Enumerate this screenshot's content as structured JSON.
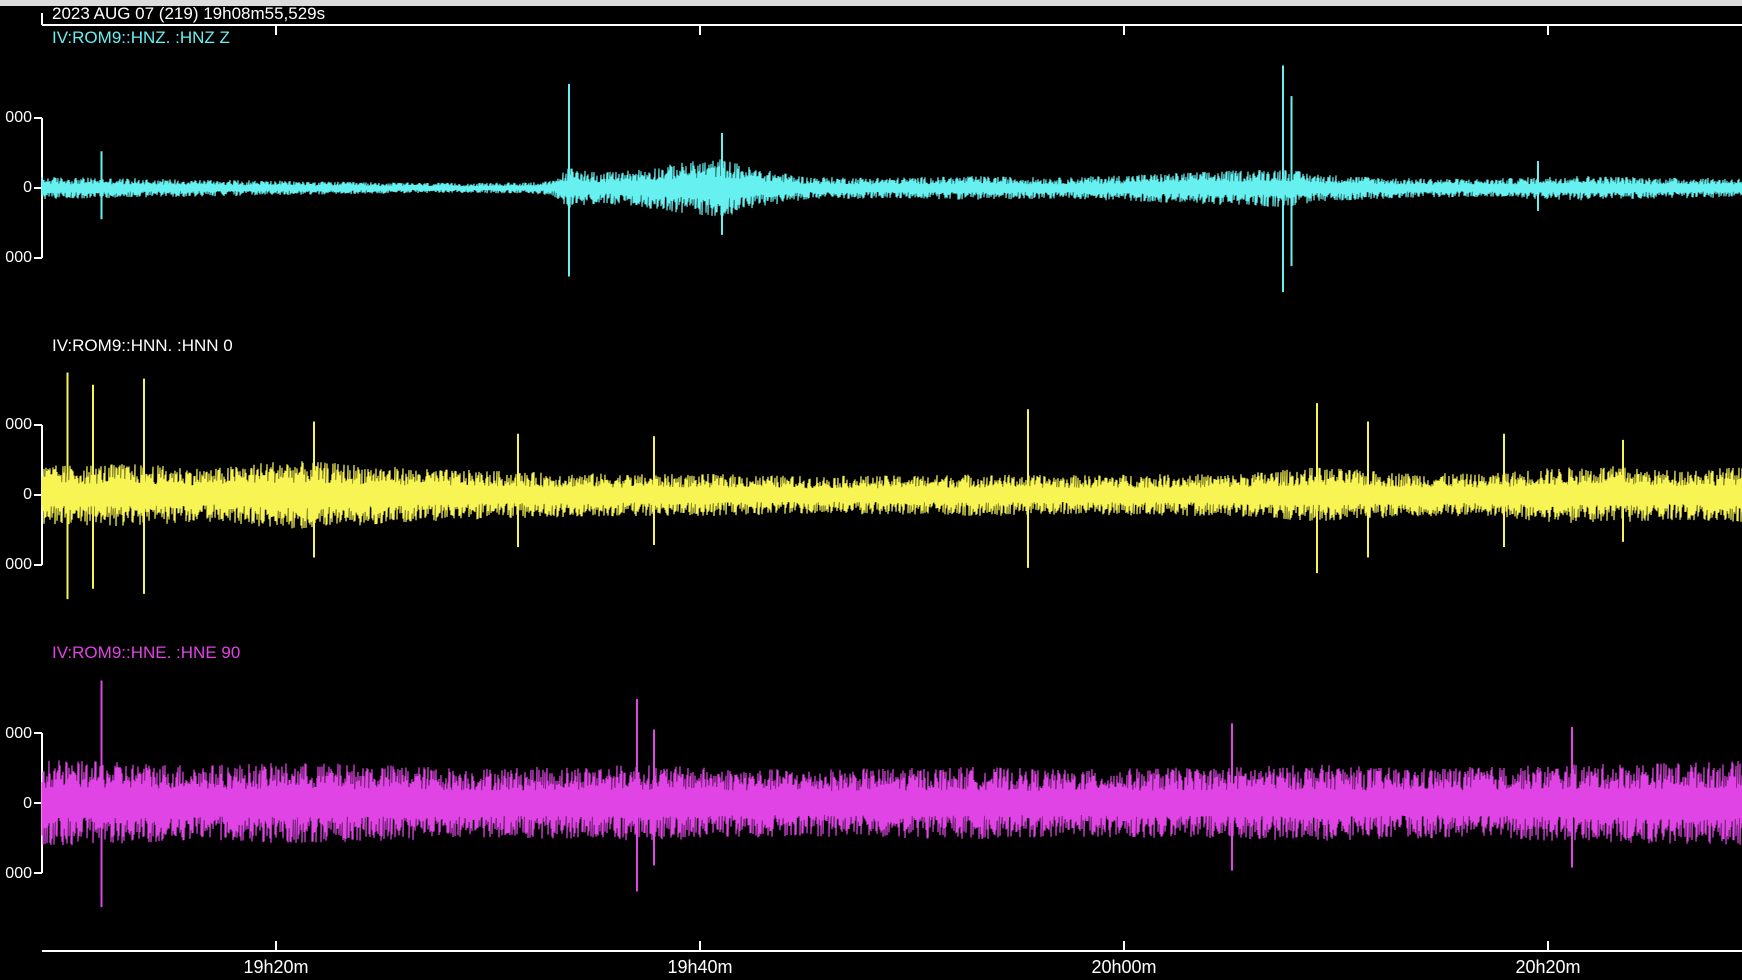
{
  "header": {
    "timestamp": "2023 AUG 07 (219)  19h08m55,529s"
  },
  "colors": {
    "background": "#000000",
    "axis": "#ffffff",
    "top_bar": "#dcdcdc"
  },
  "chart_data": {
    "type": "line",
    "title": "",
    "xlabel": "",
    "ylabel": "",
    "x_axis": {
      "start_time": "19h08m55,529s",
      "tick_labels": [
        "19h20m",
        "19h40m",
        "20h00m",
        "20h20m"
      ]
    },
    "series": [
      {
        "name": "IV:ROM9::HNZ.  :HNZ Z",
        "color": "#66f0f0",
        "ytick_labels": [
          "000",
          "0",
          "000"
        ],
        "envelope": [
          [
            0.0,
            0.16
          ],
          [
            0.05,
            0.14
          ],
          [
            0.1,
            0.12
          ],
          [
            0.15,
            0.1
          ],
          [
            0.2,
            0.08
          ],
          [
            0.25,
            0.07
          ],
          [
            0.28,
            0.08
          ],
          [
            0.3,
            0.1
          ],
          [
            0.31,
            0.3
          ],
          [
            0.33,
            0.22
          ],
          [
            0.36,
            0.3
          ],
          [
            0.38,
            0.38
          ],
          [
            0.4,
            0.42
          ],
          [
            0.42,
            0.28
          ],
          [
            0.45,
            0.16
          ],
          [
            0.5,
            0.15
          ],
          [
            0.55,
            0.17
          ],
          [
            0.6,
            0.15
          ],
          [
            0.65,
            0.2
          ],
          [
            0.7,
            0.25
          ],
          [
            0.73,
            0.28
          ],
          [
            0.75,
            0.2
          ],
          [
            0.8,
            0.14
          ],
          [
            0.85,
            0.13
          ],
          [
            0.9,
            0.18
          ],
          [
            0.95,
            0.15
          ],
          [
            1.0,
            0.14
          ]
        ],
        "spikes": [
          [
            0.035,
            0.3
          ],
          [
            0.31,
            0.85
          ],
          [
            0.4,
            0.45
          ],
          [
            0.73,
            1.0
          ],
          [
            0.735,
            0.75
          ],
          [
            0.88,
            0.22
          ]
        ]
      },
      {
        "name": "IV:ROM9::HNN.  :HNN 0",
        "color": "#f8f454",
        "ytick_labels": [
          "000",
          "0",
          "000"
        ],
        "envelope": [
          [
            0.0,
            0.42
          ],
          [
            0.05,
            0.45
          ],
          [
            0.1,
            0.38
          ],
          [
            0.14,
            0.5
          ],
          [
            0.18,
            0.45
          ],
          [
            0.22,
            0.38
          ],
          [
            0.3,
            0.32
          ],
          [
            0.35,
            0.3
          ],
          [
            0.4,
            0.3
          ],
          [
            0.45,
            0.27
          ],
          [
            0.5,
            0.28
          ],
          [
            0.55,
            0.3
          ],
          [
            0.6,
            0.28
          ],
          [
            0.65,
            0.3
          ],
          [
            0.7,
            0.3
          ],
          [
            0.75,
            0.4
          ],
          [
            0.8,
            0.32
          ],
          [
            0.85,
            0.3
          ],
          [
            0.88,
            0.38
          ],
          [
            0.92,
            0.42
          ],
          [
            0.95,
            0.36
          ],
          [
            1.0,
            0.4
          ]
        ],
        "spikes": [
          [
            0.015,
            1.0
          ],
          [
            0.03,
            0.9
          ],
          [
            0.06,
            0.95
          ],
          [
            0.16,
            0.6
          ],
          [
            0.28,
            0.5
          ],
          [
            0.36,
            0.48
          ],
          [
            0.58,
            0.7
          ],
          [
            0.75,
            0.75
          ],
          [
            0.78,
            0.6
          ],
          [
            0.86,
            0.5
          ],
          [
            0.93,
            0.45
          ]
        ]
      },
      {
        "name": "IV:ROM9::HNE.  :HNE 90",
        "color": "#e044e4",
        "ytick_labels": [
          "000",
          "0",
          "000"
        ],
        "envelope": [
          [
            0.0,
            0.62
          ],
          [
            0.05,
            0.58
          ],
          [
            0.1,
            0.55
          ],
          [
            0.15,
            0.58
          ],
          [
            0.2,
            0.55
          ],
          [
            0.25,
            0.5
          ],
          [
            0.3,
            0.52
          ],
          [
            0.35,
            0.55
          ],
          [
            0.4,
            0.5
          ],
          [
            0.45,
            0.48
          ],
          [
            0.5,
            0.5
          ],
          [
            0.55,
            0.52
          ],
          [
            0.6,
            0.48
          ],
          [
            0.65,
            0.5
          ],
          [
            0.7,
            0.52
          ],
          [
            0.75,
            0.55
          ],
          [
            0.8,
            0.5
          ],
          [
            0.85,
            0.52
          ],
          [
            0.9,
            0.55
          ],
          [
            0.95,
            0.58
          ],
          [
            1.0,
            0.6
          ]
        ],
        "spikes": [
          [
            0.035,
            1.0
          ],
          [
            0.35,
            0.85
          ],
          [
            0.36,
            0.6
          ],
          [
            0.7,
            0.65
          ],
          [
            0.9,
            0.62
          ]
        ]
      }
    ]
  }
}
